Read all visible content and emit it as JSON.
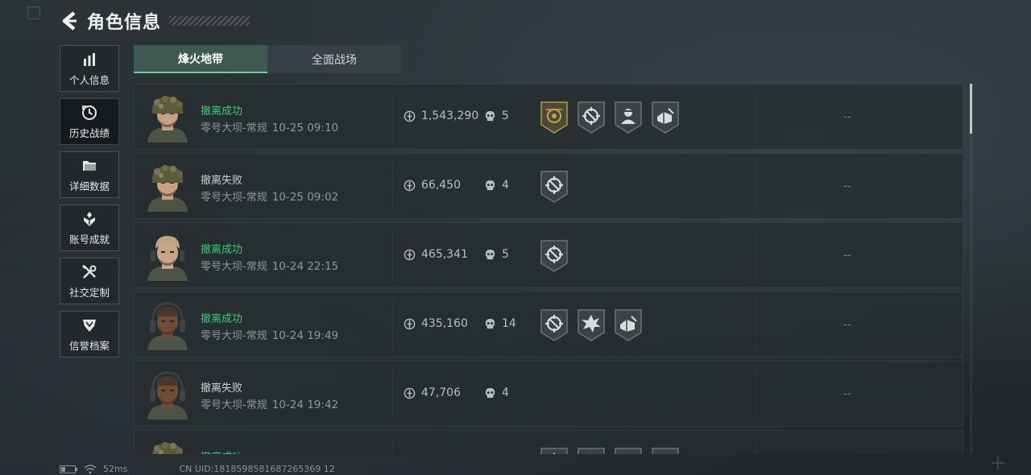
{
  "header": {
    "title": "角色信息"
  },
  "sidebar": {
    "items": [
      {
        "label": "个人信息",
        "icon": "bar-chart-icon",
        "active": false
      },
      {
        "label": "历史战绩",
        "icon": "clock-icon",
        "active": true
      },
      {
        "label": "详细数据",
        "icon": "folder-icon",
        "active": false
      },
      {
        "label": "账号成就",
        "icon": "trophy-icon",
        "active": false
      },
      {
        "label": "社交定制",
        "icon": "tools-icon",
        "active": false
      },
      {
        "label": "信誉档案",
        "icon": "shield-icon",
        "active": false
      }
    ]
  },
  "tabs": [
    {
      "label": "烽火地带",
      "active": true
    },
    {
      "label": "全面战场",
      "active": false
    }
  ],
  "records": [
    {
      "status": "撤离成功",
      "result": "success",
      "map": "零号大坝-常规",
      "time": "10-25 09:10",
      "value": "1,543,290",
      "kills": "5",
      "badges": [
        "gold-emblem-badge",
        "crosshair-badge",
        "operator-badge",
        "cargo-badge"
      ],
      "extra": "--",
      "avatar": "camo-helmet"
    },
    {
      "status": "撤离失败",
      "result": "fail",
      "map": "零号大坝-常规",
      "time": "10-25 09:02",
      "value": "66,450",
      "kills": "4",
      "badges": [
        "crosshair-badge"
      ],
      "extra": "--",
      "avatar": "camo-helmet"
    },
    {
      "status": "撤离成功",
      "result": "success",
      "map": "零号大坝-常规",
      "time": "10-24 22:15",
      "value": "465,341",
      "kills": "5",
      "badges": [
        "crosshair-badge"
      ],
      "extra": "--",
      "avatar": "headset-blond"
    },
    {
      "status": "撤离成功",
      "result": "success",
      "map": "零号大坝-常规",
      "time": "10-24 19:49",
      "value": "435,160",
      "kills": "14",
      "badges": [
        "crosshair-badge",
        "explosion-badge",
        "cargo-badge"
      ],
      "extra": "--",
      "avatar": "headset-dark"
    },
    {
      "status": "撤离失败",
      "result": "fail",
      "map": "零号大坝-常规",
      "time": "10-24 19:42",
      "value": "47,706",
      "kills": "4",
      "badges": [],
      "extra": "--",
      "avatar": "headset-dark"
    },
    {
      "status": "撤离成功",
      "result": "success",
      "map": "",
      "time": "",
      "value": "",
      "kills": "",
      "badges": [
        "crosshair-badge",
        "explosion-badge",
        "operator-badge",
        "cargo-badge"
      ],
      "extra": "",
      "avatar": "camo-helmet"
    }
  ],
  "footer": {
    "ping": "52ms",
    "uid": "CN UID:1818598581687265369 12"
  },
  "colors": {
    "success": "#3fc67a",
    "accent": "#6fcf9d",
    "tab_active_bg": "#3d5952",
    "gold": "#b8963a"
  }
}
